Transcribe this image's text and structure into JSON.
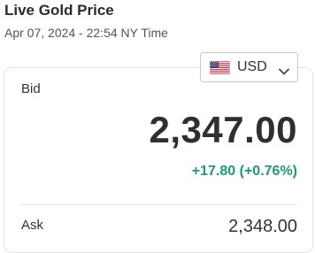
{
  "header": {
    "title": "Live Gold Price",
    "timestamp": "Apr 07, 2024 - 22:54 NY Time"
  },
  "currency": {
    "selected": "USD",
    "flag_icon": "us-flag-icon"
  },
  "bid": {
    "label": "Bid",
    "price": "2,347.00",
    "change": "+17.80 (+0.76%)"
  },
  "ask": {
    "label": "Ask",
    "price": "2,348.00"
  },
  "colors": {
    "positive_change": "#1a9b75",
    "price_text": "#2f2f2f"
  }
}
